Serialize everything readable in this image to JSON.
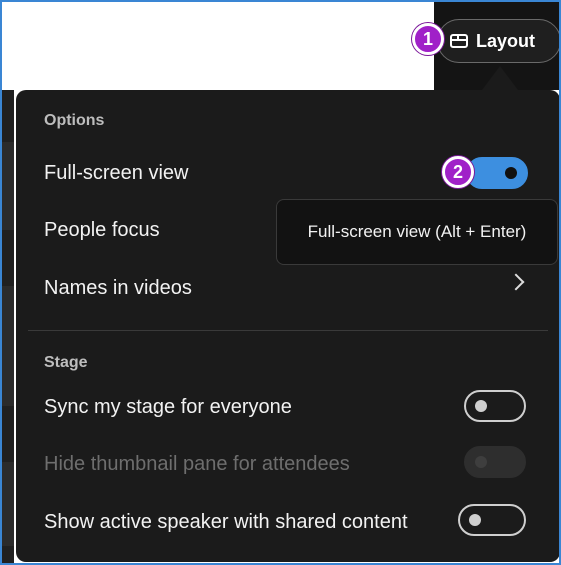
{
  "layout_button": {
    "label": "Layout",
    "icon": "layout-icon"
  },
  "badges": {
    "step1": "1",
    "step2": "2"
  },
  "options_section": {
    "label": "Options",
    "items": [
      {
        "label": "Full-screen view",
        "control": "toggle",
        "state": "on"
      },
      {
        "label": "People focus"
      },
      {
        "label": "Names in videos",
        "control": "chevron"
      }
    ]
  },
  "stage_section": {
    "label": "Stage",
    "items": [
      {
        "label": "Sync my stage for everyone",
        "control": "toggle",
        "state": "off"
      },
      {
        "label": "Hide thumbnail pane for attendees",
        "control": "toggle",
        "state": "disabled"
      },
      {
        "label": "Show active speaker with shared content",
        "control": "toggle",
        "state": "off"
      }
    ]
  },
  "tooltip": {
    "text": "Full-screen view (Alt + Enter)"
  },
  "colors": {
    "panel_bg": "#1b1b1b",
    "toggle_on": "#3d8fe0",
    "badge": "#a020c8",
    "frame_border": "#3a86d4"
  }
}
